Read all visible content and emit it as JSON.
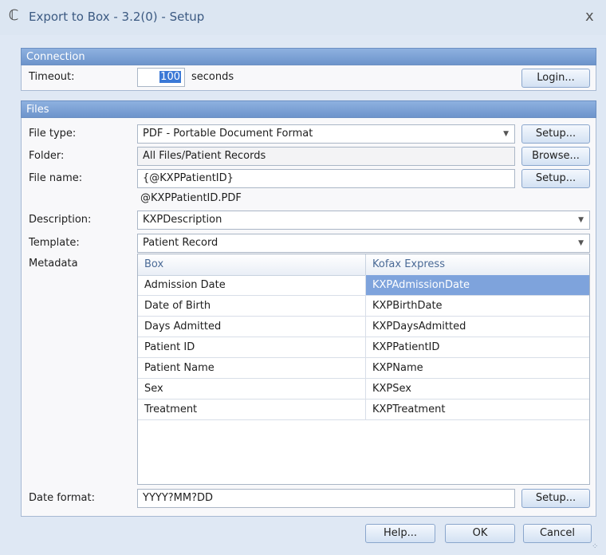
{
  "window": {
    "title": "Export to Box - 3.2(0) - Setup",
    "close_glyph": "x",
    "app_icon": "app-logo-icon"
  },
  "connection": {
    "header": "Connection",
    "timeout_label": "Timeout:",
    "timeout_value": "100",
    "timeout_unit": "seconds",
    "login_button": "Login..."
  },
  "files": {
    "header": "Files",
    "file_type_label": "File type:",
    "file_type_value": "PDF - Portable Document Format",
    "file_type_setup": "Setup...",
    "folder_label": "Folder:",
    "folder_value": "All Files/Patient Records",
    "browse_button": "Browse...",
    "file_name_label": "File name:",
    "file_name_value": "{@KXPPatientID}",
    "file_name_setup": "Setup...",
    "file_name_preview": "@KXPPatientID.PDF",
    "description_label": "Description:",
    "description_value": "KXPDescription",
    "template_label": "Template:",
    "template_value": "Patient Record",
    "metadata_label": "Metadata",
    "metadata_columns": [
      "Box",
      "Kofax Express"
    ],
    "metadata_rows": [
      {
        "box": "Admission Date",
        "kofax": "KXPAdmissionDate"
      },
      {
        "box": "Date of Birth",
        "kofax": "KXPBirthDate"
      },
      {
        "box": "Days Admitted",
        "kofax": "KXPDaysAdmitted"
      },
      {
        "box": "Patient ID",
        "kofax": "KXPPatientID"
      },
      {
        "box": "Patient Name",
        "kofax": "KXPName"
      },
      {
        "box": "Sex",
        "kofax": "KXPSex"
      },
      {
        "box": "Treatment",
        "kofax": "KXPTreatment"
      }
    ],
    "date_format_label": "Date format:",
    "date_format_value": "YYYY?MM?DD",
    "date_format_setup": "Setup..."
  },
  "footer": {
    "help_button": "Help...",
    "ok_button": "OK",
    "cancel_button": "Cancel"
  },
  "colors": {
    "section_header": "#7ea3dc",
    "selection": "#7ea3dc",
    "title_text": "#3c5a82"
  }
}
